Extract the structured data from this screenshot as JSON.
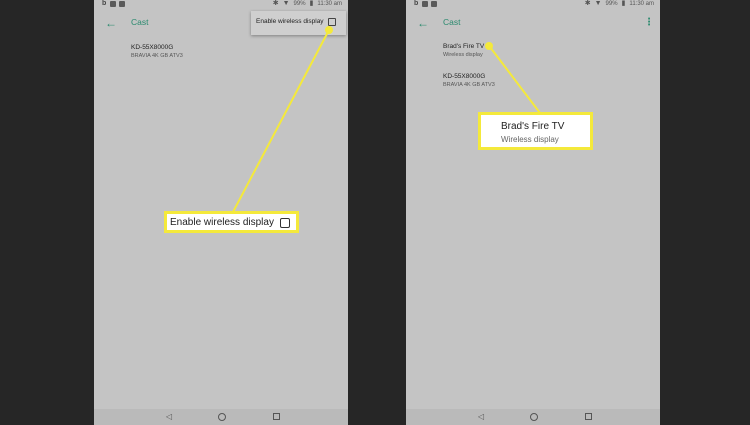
{
  "colors": {
    "accent": "#2a8a6e",
    "highlight": "#f4e93b",
    "screen_bg": "#c4c4c4",
    "frame_bg": "#262626"
  },
  "left_screen": {
    "status": {
      "battery": "99%",
      "time": "11:30 am"
    },
    "appbar": {
      "title": "Cast",
      "back_icon": "arrow-left-icon"
    },
    "menu": {
      "item_label": "Enable wireless display",
      "checked": false
    },
    "devices": [
      {
        "name": "KD-55X8000G",
        "subtitle": "BRAVIA 4K GB ATV3"
      }
    ],
    "callout": {
      "label": "Enable wireless display",
      "checked": false
    }
  },
  "right_screen": {
    "status": {
      "battery": "99%",
      "time": "11:30 am"
    },
    "appbar": {
      "title": "Cast",
      "back_icon": "arrow-left-icon",
      "overflow_icon": "more-vert-icon"
    },
    "devices": [
      {
        "name": "Brad's Fire TV",
        "subtitle": "Wireless display"
      },
      {
        "name": "KD-55X8000G",
        "subtitle": "BRAVIA 4K GB ATV3"
      }
    ],
    "callout": {
      "title": "Brad's Fire TV",
      "subtitle": "Wireless display"
    }
  }
}
